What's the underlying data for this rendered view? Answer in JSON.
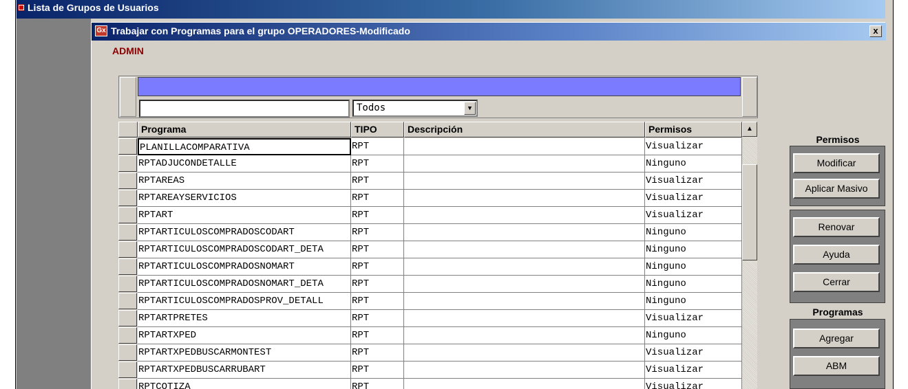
{
  "back_window": {
    "title": "Lista de Grupos de Usuarios"
  },
  "dialog": {
    "title": "Trabajar con Programas para el grupo OPERADORES-Modificado",
    "icon_text": "Gx",
    "close_label": "x",
    "user_label": "ADMIN"
  },
  "filter": {
    "text_value": "",
    "type_selected": "Todos"
  },
  "table": {
    "headers": {
      "programa": "Programa",
      "tipo": "TIPO",
      "descripcion": "Descripción",
      "permisos": "Permisos"
    },
    "rows": [
      {
        "programa": "PLANILLACOMPARATIVA",
        "tipo": "RPT",
        "descripcion": "",
        "permisos": "Visualizar"
      },
      {
        "programa": "RPTADJUCONDETALLE",
        "tipo": "RPT",
        "descripcion": "",
        "permisos": "Ninguno"
      },
      {
        "programa": "RPTAREAS",
        "tipo": "RPT",
        "descripcion": "",
        "permisos": "Visualizar"
      },
      {
        "programa": "RPTAREAYSERVICIOS",
        "tipo": "RPT",
        "descripcion": "",
        "permisos": "Visualizar"
      },
      {
        "programa": "RPTART",
        "tipo": "RPT",
        "descripcion": "",
        "permisos": "Visualizar"
      },
      {
        "programa": "RPTARTICULOSCOMPRADOSCODART",
        "tipo": "RPT",
        "descripcion": "",
        "permisos": "Ninguno"
      },
      {
        "programa": "RPTARTICULOSCOMPRADOSCODART_DETA",
        "tipo": "RPT",
        "descripcion": "",
        "permisos": "Ninguno"
      },
      {
        "programa": "RPTARTICULOSCOMPRADOSNOMART",
        "tipo": "RPT",
        "descripcion": "",
        "permisos": "Ninguno"
      },
      {
        "programa": "RPTARTICULOSCOMPRADOSNOMART_DETA",
        "tipo": "RPT",
        "descripcion": "",
        "permisos": "Ninguno"
      },
      {
        "programa": "RPTARTICULOSCOMPRADOSPROV_DETALL",
        "tipo": "RPT",
        "descripcion": "",
        "permisos": "Ninguno"
      },
      {
        "programa": "RPTARTPRETES",
        "tipo": "RPT",
        "descripcion": "",
        "permisos": "Visualizar"
      },
      {
        "programa": "RPTARTXPED",
        "tipo": "RPT",
        "descripcion": "",
        "permisos": "Ninguno"
      },
      {
        "programa": "RPTARTXPEDBUSCARMONTEST",
        "tipo": "RPT",
        "descripcion": "",
        "permisos": "Visualizar"
      },
      {
        "programa": "RPTARTXPEDBUSCARRUBART",
        "tipo": "RPT",
        "descripcion": "",
        "permisos": "Visualizar"
      },
      {
        "programa": "RPTCOTIZA",
        "tipo": "RPT",
        "descripcion": "",
        "permisos": "Visualizar"
      }
    ]
  },
  "panel": {
    "permisos_title": "Permisos",
    "modificar": "Modificar",
    "aplicar_masivo": "Aplicar Masivo",
    "renovar": "Renovar",
    "ayuda": "Ayuda",
    "cerrar": "Cerrar",
    "programas_title": "Programas",
    "agregar": "Agregar",
    "abm": "ABM"
  },
  "icons": {
    "app_icon": "genexus-icon",
    "close": "close-icon",
    "dropdown": "chevron-down-icon",
    "scroll_up": "arrow-up-icon"
  }
}
